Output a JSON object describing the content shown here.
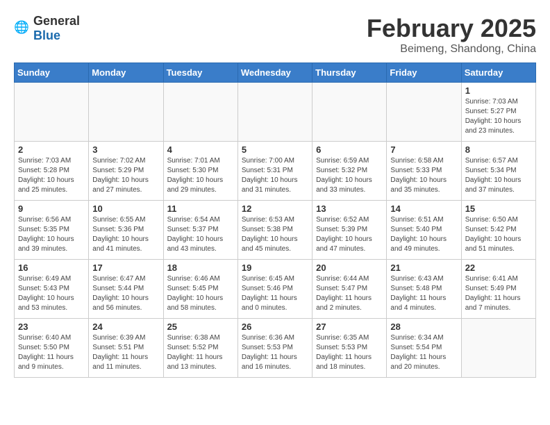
{
  "logo": {
    "general": "General",
    "blue": "Blue"
  },
  "title": "February 2025",
  "subtitle": "Beimeng, Shandong, China",
  "weekdays": [
    "Sunday",
    "Monday",
    "Tuesday",
    "Wednesday",
    "Thursday",
    "Friday",
    "Saturday"
  ],
  "weeks": [
    [
      {
        "day": "",
        "info": ""
      },
      {
        "day": "",
        "info": ""
      },
      {
        "day": "",
        "info": ""
      },
      {
        "day": "",
        "info": ""
      },
      {
        "day": "",
        "info": ""
      },
      {
        "day": "",
        "info": ""
      },
      {
        "day": "1",
        "info": "Sunrise: 7:03 AM\nSunset: 5:27 PM\nDaylight: 10 hours\nand 23 minutes."
      }
    ],
    [
      {
        "day": "2",
        "info": "Sunrise: 7:03 AM\nSunset: 5:28 PM\nDaylight: 10 hours\nand 25 minutes."
      },
      {
        "day": "3",
        "info": "Sunrise: 7:02 AM\nSunset: 5:29 PM\nDaylight: 10 hours\nand 27 minutes."
      },
      {
        "day": "4",
        "info": "Sunrise: 7:01 AM\nSunset: 5:30 PM\nDaylight: 10 hours\nand 29 minutes."
      },
      {
        "day": "5",
        "info": "Sunrise: 7:00 AM\nSunset: 5:31 PM\nDaylight: 10 hours\nand 31 minutes."
      },
      {
        "day": "6",
        "info": "Sunrise: 6:59 AM\nSunset: 5:32 PM\nDaylight: 10 hours\nand 33 minutes."
      },
      {
        "day": "7",
        "info": "Sunrise: 6:58 AM\nSunset: 5:33 PM\nDaylight: 10 hours\nand 35 minutes."
      },
      {
        "day": "8",
        "info": "Sunrise: 6:57 AM\nSunset: 5:34 PM\nDaylight: 10 hours\nand 37 minutes."
      }
    ],
    [
      {
        "day": "9",
        "info": "Sunrise: 6:56 AM\nSunset: 5:35 PM\nDaylight: 10 hours\nand 39 minutes."
      },
      {
        "day": "10",
        "info": "Sunrise: 6:55 AM\nSunset: 5:36 PM\nDaylight: 10 hours\nand 41 minutes."
      },
      {
        "day": "11",
        "info": "Sunrise: 6:54 AM\nSunset: 5:37 PM\nDaylight: 10 hours\nand 43 minutes."
      },
      {
        "day": "12",
        "info": "Sunrise: 6:53 AM\nSunset: 5:38 PM\nDaylight: 10 hours\nand 45 minutes."
      },
      {
        "day": "13",
        "info": "Sunrise: 6:52 AM\nSunset: 5:39 PM\nDaylight: 10 hours\nand 47 minutes."
      },
      {
        "day": "14",
        "info": "Sunrise: 6:51 AM\nSunset: 5:40 PM\nDaylight: 10 hours\nand 49 minutes."
      },
      {
        "day": "15",
        "info": "Sunrise: 6:50 AM\nSunset: 5:42 PM\nDaylight: 10 hours\nand 51 minutes."
      }
    ],
    [
      {
        "day": "16",
        "info": "Sunrise: 6:49 AM\nSunset: 5:43 PM\nDaylight: 10 hours\nand 53 minutes."
      },
      {
        "day": "17",
        "info": "Sunrise: 6:47 AM\nSunset: 5:44 PM\nDaylight: 10 hours\nand 56 minutes."
      },
      {
        "day": "18",
        "info": "Sunrise: 6:46 AM\nSunset: 5:45 PM\nDaylight: 10 hours\nand 58 minutes."
      },
      {
        "day": "19",
        "info": "Sunrise: 6:45 AM\nSunset: 5:46 PM\nDaylight: 11 hours\nand 0 minutes."
      },
      {
        "day": "20",
        "info": "Sunrise: 6:44 AM\nSunset: 5:47 PM\nDaylight: 11 hours\nand 2 minutes."
      },
      {
        "day": "21",
        "info": "Sunrise: 6:43 AM\nSunset: 5:48 PM\nDaylight: 11 hours\nand 4 minutes."
      },
      {
        "day": "22",
        "info": "Sunrise: 6:41 AM\nSunset: 5:49 PM\nDaylight: 11 hours\nand 7 minutes."
      }
    ],
    [
      {
        "day": "23",
        "info": "Sunrise: 6:40 AM\nSunset: 5:50 PM\nDaylight: 11 hours\nand 9 minutes."
      },
      {
        "day": "24",
        "info": "Sunrise: 6:39 AM\nSunset: 5:51 PM\nDaylight: 11 hours\nand 11 minutes."
      },
      {
        "day": "25",
        "info": "Sunrise: 6:38 AM\nSunset: 5:52 PM\nDaylight: 11 hours\nand 13 minutes."
      },
      {
        "day": "26",
        "info": "Sunrise: 6:36 AM\nSunset: 5:53 PM\nDaylight: 11 hours\nand 16 minutes."
      },
      {
        "day": "27",
        "info": "Sunrise: 6:35 AM\nSunset: 5:53 PM\nDaylight: 11 hours\nand 18 minutes."
      },
      {
        "day": "28",
        "info": "Sunrise: 6:34 AM\nSunset: 5:54 PM\nDaylight: 11 hours\nand 20 minutes."
      },
      {
        "day": "",
        "info": ""
      }
    ]
  ]
}
